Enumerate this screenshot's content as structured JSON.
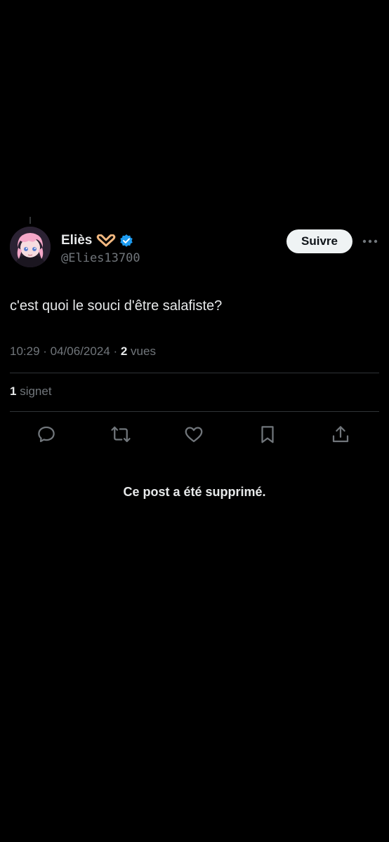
{
  "tweet": {
    "author": {
      "name": "Eliès",
      "handle": "@Elies13700",
      "verified": true,
      "avatar": "anime-avatar-pink-hair",
      "emoji": "heart-hands-emoji"
    },
    "follow_label": "Suivre",
    "text": "c'est quoi le souci d'être salafiste?",
    "timestamp": "10:29 · 04/06/2024 · ",
    "views_count": "2",
    "views_label": " vues",
    "bookmarks_count": "1",
    "bookmarks_label": " signet",
    "actions": [
      "reply-icon",
      "repost-icon",
      "like-icon",
      "bookmark-icon",
      "share-icon"
    ]
  },
  "notice": "Ce post a été supprimé.",
  "colors": {
    "background": "#000000",
    "text": "#e7e9ea",
    "secondary": "#71767b",
    "divider": "#2f3336",
    "verified": "#1d9bf0",
    "follow_bg": "#eff3f4"
  }
}
